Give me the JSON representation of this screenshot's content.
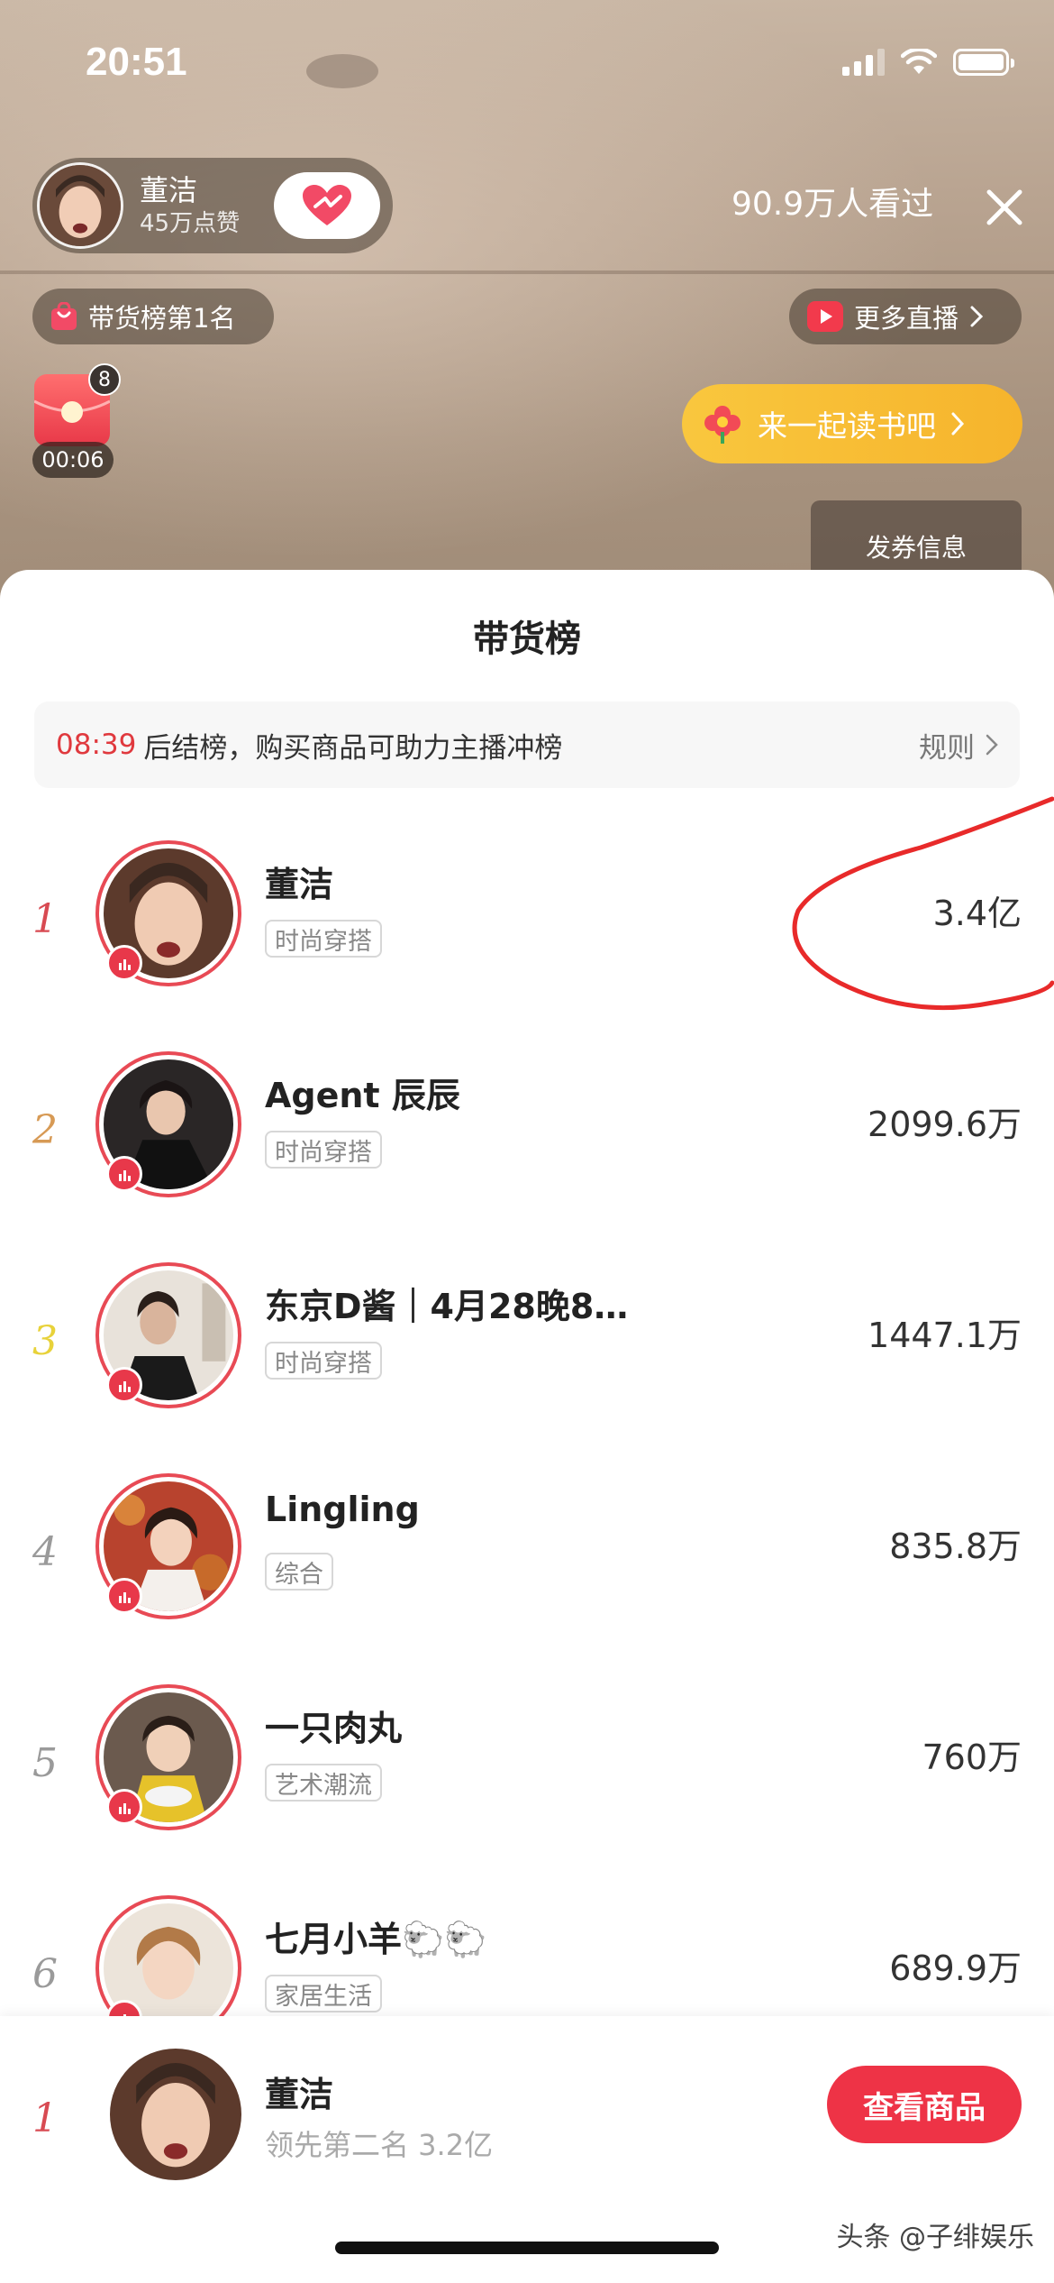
{
  "status_bar": {
    "time": "20:51"
  },
  "live_header": {
    "host_name": "董洁",
    "host_likes": "45万点赞",
    "viewers": "90.9万人看过",
    "rank_pill": "带货榜第1名",
    "more_live": "更多直播",
    "redpacket_count": "8",
    "countdown": "00:06",
    "read_button": "来一起读书吧",
    "coupon_button": "发券信息"
  },
  "sheet": {
    "title": "带货榜",
    "notice_time": "08:39",
    "notice_text": "后结榜，购买商品可助力主播冲榜",
    "rules_label": "规则"
  },
  "rankings": [
    {
      "rank": "1",
      "name": "董洁",
      "tag": "时尚穿搭",
      "value": "3.4亿"
    },
    {
      "rank": "2",
      "name": "Agent 辰辰",
      "tag": "时尚穿搭",
      "value": "2099.6万"
    },
    {
      "rank": "3",
      "name": "东京D酱｜4月28晚8…",
      "tag": "时尚穿搭",
      "value": "1447.1万"
    },
    {
      "rank": "4",
      "name": "Lingling",
      "tag": "综合",
      "value": "835.8万"
    },
    {
      "rank": "5",
      "name": "一只肉丸",
      "tag": "艺术潮流",
      "value": "760万"
    },
    {
      "rank": "6",
      "name": "七月小羊🐑🐑",
      "tag": "家居生活",
      "value": "689.9万"
    }
  ],
  "rank_colors": {
    "1": "#d84a52",
    "2": "#d79a55",
    "3": "#e8d23a",
    "4": "#9a9a9a",
    "5": "#9a9a9a",
    "6": "#9a9a9a"
  },
  "bottom_bar": {
    "rank": "1",
    "name": "董洁",
    "subtitle": "领先第二名 3.2亿",
    "button": "查看商品"
  },
  "watermark": "头条 @子绯娱乐"
}
